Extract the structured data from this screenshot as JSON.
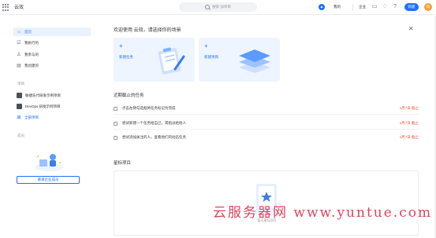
{
  "topbar": {
    "app_title": "云效",
    "search_placeholder": "搜索 加项目",
    "rocket_icon": "rocket-icon",
    "my_label": "我的",
    "workspace_label": "企业",
    "new_button": "新建",
    "avatar_text": "云"
  },
  "sidebar": {
    "nav": [
      {
        "label": "首页",
        "icon": "home-icon"
      },
      {
        "label": "我执行的",
        "icon": "check-list-icon"
      },
      {
        "label": "我参与的",
        "icon": "user-icon"
      },
      {
        "label": "我创建的",
        "icon": "document-icon"
      }
    ],
    "projects_section": "项目",
    "projects": [
      {
        "label": "敏捷迭代研发示例项目"
      },
      {
        "label": "DevOps 研发示例项目"
      },
      {
        "label": "全部项目",
        "icon": "grid-icon"
      }
    ],
    "members_section": "成员",
    "invite_button": "邀请企业成员"
  },
  "main": {
    "welcome": "欢迎使用 云效，请选择你的场景",
    "cards": [
      {
        "label": "新建任务",
        "plus": "+"
      },
      {
        "label": "新建项目",
        "plus": "+"
      }
    ],
    "tasks_title": "近期截止的任务",
    "tasks": [
      {
        "text": "点击左侧勾选框将任务标记为完成",
        "date": "1月7日 截止"
      },
      {
        "text": "尝试新建一个任务给自己，或指派给他人",
        "date": "1月7日 截止"
      },
      {
        "text": "尝试添加关注的人，查看他们的动态任务",
        "date": "1月7日 截止"
      }
    ],
    "fav_title": "星标项目",
    "fav_empty": "暂无星标项目"
  },
  "watermark": "云服务器网 www.yuntue.com",
  "colors": {
    "accent": "#1e6fff",
    "date_red": "#f0502e",
    "card_bg": "#eef5ff",
    "watermark": "#e0435a"
  }
}
